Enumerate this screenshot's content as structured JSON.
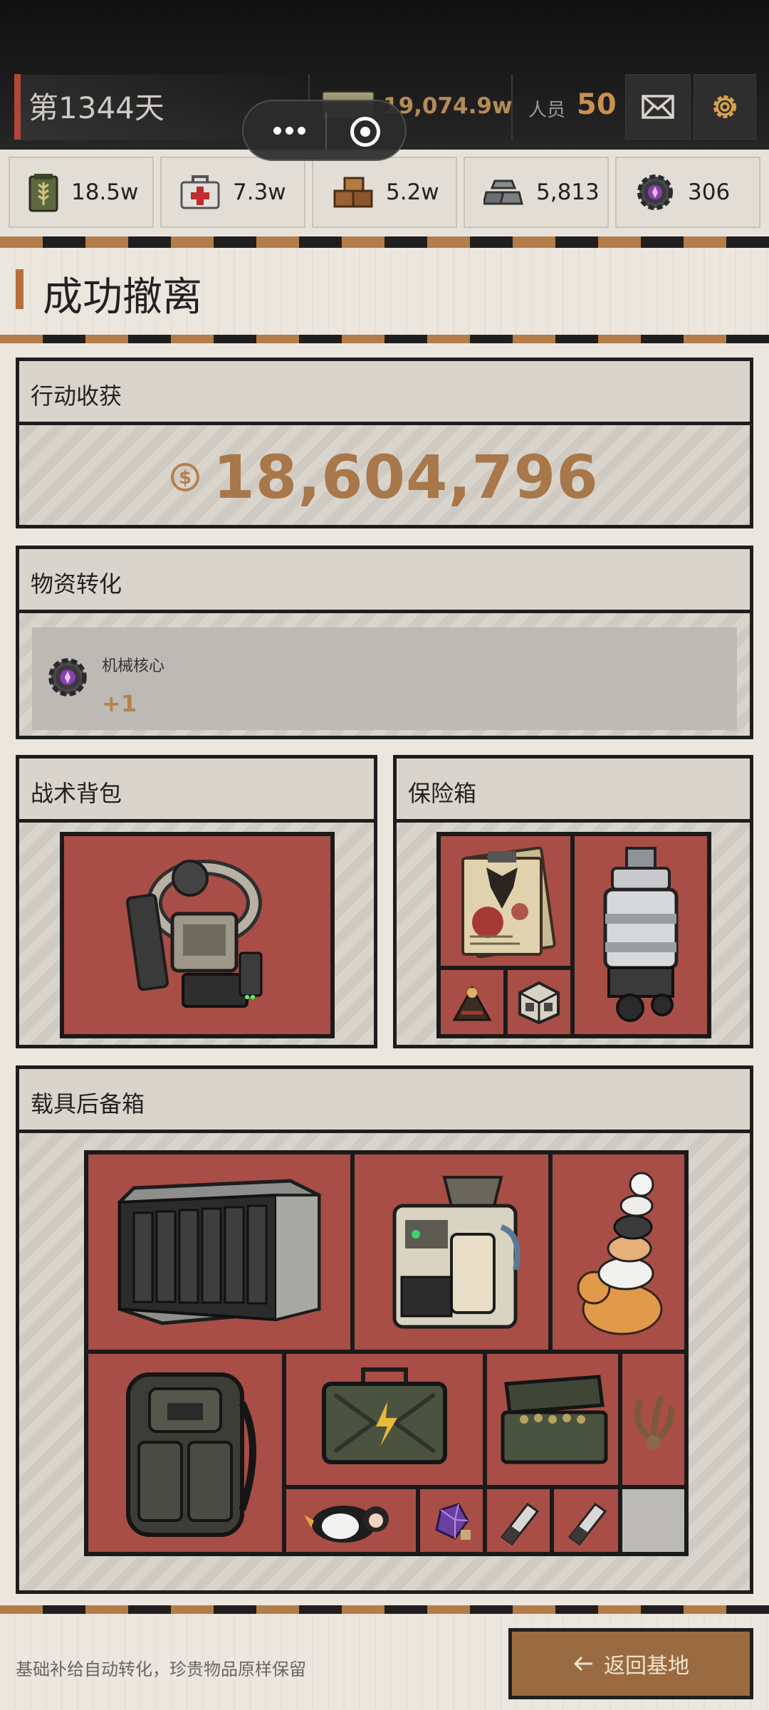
{
  "header": {
    "day": "第1344天",
    "money": "19,074.9w",
    "staff_label": "人员",
    "staff_count": "50",
    "icons": [
      "banknote-icon",
      "mail-icon",
      "settings-gear-icon"
    ]
  },
  "miniprogram_capsule": {
    "icons": [
      "more-dots-icon",
      "close-target-icon"
    ]
  },
  "resources": [
    {
      "icon": "grain-crate-icon",
      "value": "18.5w"
    },
    {
      "icon": "medkit-icon",
      "value": "7.3w"
    },
    {
      "icon": "wood-blocks-icon",
      "value": "5.2w"
    },
    {
      "icon": "metal-ingots-icon",
      "value": "5,813"
    },
    {
      "icon": "mech-core-gear-icon",
      "value": "306"
    }
  ],
  "page_title": "成功撤离",
  "action_gain": {
    "title": "行动收获",
    "amount": "18,604,796",
    "currency_icon": "dollar-coin-icon"
  },
  "conversion": {
    "title": "物资转化",
    "item_name": "机械核心",
    "item_delta": "+1",
    "item_icon": "mech-core-gear-icon"
  },
  "tactical_backpack": {
    "title": "战术背包",
    "items": [
      "mech-exoskeleton-icon"
    ]
  },
  "safe_box": {
    "title": "保险箱",
    "items": [
      "bloody-document-icon",
      "drill-engine-icon",
      "crossbow-figure-icon",
      "small-cube-icon"
    ]
  },
  "vehicle_trunk": {
    "title": "载具后备箱",
    "items": [
      "nas-server-icon",
      "coffee-machine-icon",
      "cat-stack-icon",
      "tactical-backpack-icon",
      "battery-case-icon",
      "ammo-case-icon",
      "claw-icon",
      "penguin-plush-icon",
      "purple-crystal-icon",
      "usb-drive-icon",
      "usb-drive-icon",
      "empty-slot"
    ]
  },
  "footer": {
    "note": "基础补给自动转化，珍贵物品原样保留",
    "back_button": "返回基地",
    "back_icon": "arrow-left-icon"
  },
  "colors": {
    "accent": "#b7703a",
    "gold": "#b58b57",
    "item_cell": "#a84e46",
    "danger": "#b24638"
  }
}
